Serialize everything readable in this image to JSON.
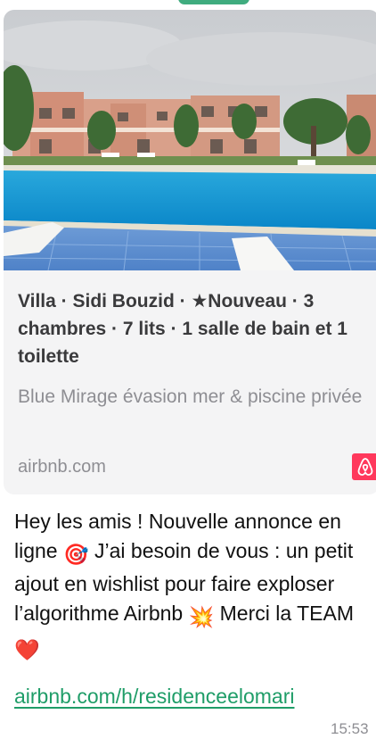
{
  "preview": {
    "title": "Villa · Sidi Bouzid · ★Nouveau · 3 chambres · 7 lits · 1 salle de bain et 1 toilette",
    "description": "Blue Mirage évasion mer & piscine privée",
    "domain": "airbnb.com",
    "icon": "airbnb-logo-icon"
  },
  "message": {
    "line1": "Hey les amis ! Nouvelle annonce en ligne",
    "emoji1": "🎯",
    "line2": " J’ai besoin de vous : un petit ajout en wishlist pour faire exploser l’algorithme Airbnb",
    "emoji2": "💥",
    "line3": " Merci la TEAM",
    "emoji3": "❤️",
    "link": "airbnb.com/h/residenceelomari",
    "time": "15:53"
  },
  "colors": {
    "link": "#1f9d68",
    "airbnb": "#ff385c",
    "card": "#f4f4f5"
  }
}
